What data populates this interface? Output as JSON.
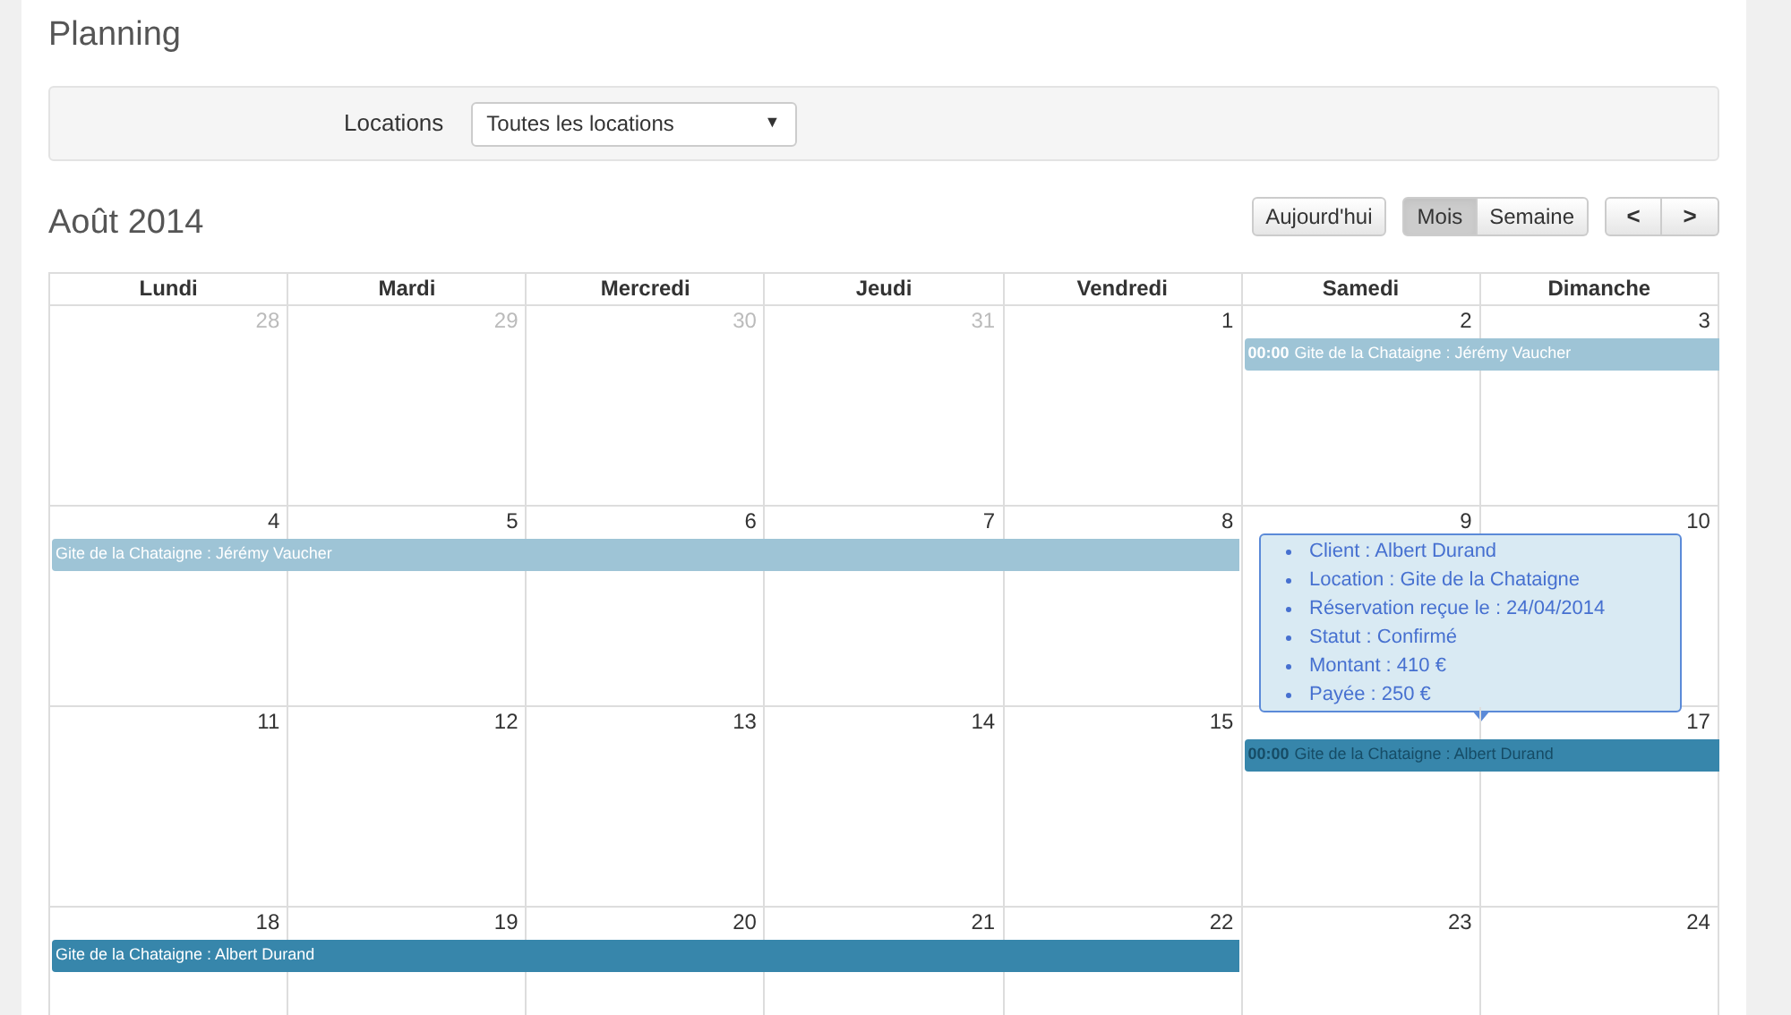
{
  "page_title": "Planning",
  "filter": {
    "label": "Locations",
    "value": "Toutes les locations",
    "arrow": "▼"
  },
  "month_title": "Août 2014",
  "today_button": "Aujourd'hui",
  "views": [
    {
      "label": "Mois",
      "selected": true
    },
    {
      "label": "Semaine",
      "selected": false
    }
  ],
  "nav": [
    "<",
    ">"
  ],
  "weekdays": [
    "Lundi",
    "Mardi",
    "Mercredi",
    "Jeudi",
    "Vendredi",
    "Samedi",
    "Dimanche"
  ],
  "weeks": [
    {
      "days": [
        {
          "number": "28",
          "other_month": true
        },
        {
          "number": "29",
          "other_month": true
        },
        {
          "number": "30",
          "other_month": true
        },
        {
          "number": "31",
          "other_month": true
        },
        {
          "number": "1",
          "other_month": false
        },
        {
          "number": "2",
          "other_month": false
        },
        {
          "number": "3",
          "other_month": false
        }
      ],
      "events": [
        {
          "kind": "weekend",
          "time": "00:00",
          "title": "Gite de la Chataigne : Jérémy Vaucher",
          "color": "#9ec4d6",
          "selected": false
        }
      ]
    },
    {
      "days": [
        {
          "number": "4",
          "other_month": false
        },
        {
          "number": "5",
          "other_month": false
        },
        {
          "number": "6",
          "other_month": false
        },
        {
          "number": "7",
          "other_month": false
        },
        {
          "number": "8",
          "other_month": false
        },
        {
          "number": "9",
          "other_month": false
        },
        {
          "number": "10",
          "other_month": false
        }
      ],
      "events": [
        {
          "kind": "workweek",
          "title": "Gite de la Chataigne : Jérémy Vaucher",
          "color": "#9ec4d6",
          "selected": false
        }
      ]
    },
    {
      "days": [
        {
          "number": "11",
          "other_month": false
        },
        {
          "number": "12",
          "other_month": false
        },
        {
          "number": "13",
          "other_month": false
        },
        {
          "number": "14",
          "other_month": false
        },
        {
          "number": "15",
          "other_month": false
        },
        {
          "other_month": false
        },
        {
          "number": "17",
          "other_month": false
        }
      ],
      "events": [
        {
          "kind": "weekend",
          "time": "00:00",
          "title": "Gite de la Chataigne : Albert Durand",
          "color": "#3786ab",
          "selected": true
        }
      ]
    },
    {
      "days": [
        {
          "number": "18",
          "other_month": false
        },
        {
          "number": "19",
          "other_month": false
        },
        {
          "number": "20",
          "other_month": false
        },
        {
          "number": "21",
          "other_month": false
        },
        {
          "number": "22",
          "other_month": false
        },
        {
          "number": "23",
          "other_month": false
        },
        {
          "number": "24",
          "other_month": false
        }
      ],
      "events": [
        {
          "kind": "workweek",
          "title": "Gite de la Chataigne : Albert Durand",
          "color": "#3786ab",
          "selected": false
        }
      ]
    }
  ],
  "tooltip": {
    "lines": [
      "Client : Albert Durand",
      "Location : Gite de la Chataigne",
      "Réservation reçue le : 24/04/2014",
      "Statut : Confirmé",
      "Montant : 410 €",
      "Payée : 250 €"
    ]
  }
}
